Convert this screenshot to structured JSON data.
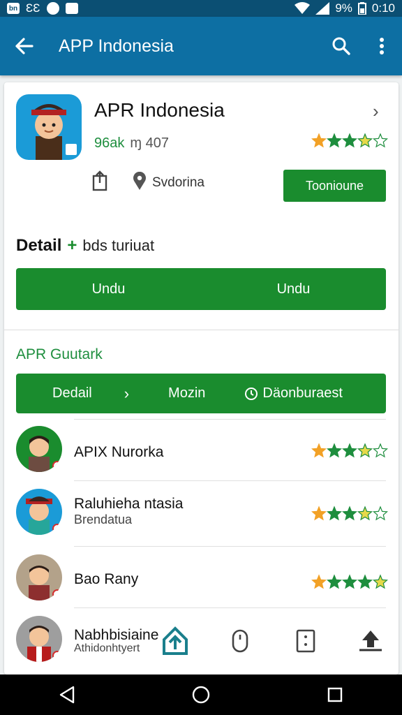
{
  "status_bar": {
    "left_box_text": "bn",
    "left_text": "ƐƐ",
    "battery_percent": "9%",
    "time": "0:10"
  },
  "app_bar": {
    "title": "APP Indonesia",
    "back_icon": "arrow-left-icon",
    "search_icon": "search-icon",
    "menu_icon": "more-vert-icon"
  },
  "app_header": {
    "name": "APR Indonesia",
    "meta_green": "96ak",
    "meta_gray": "ɱ 407",
    "rating": 3.5,
    "location": "Svdorina",
    "primary_button": "Toonioune"
  },
  "detail": {
    "heading_bold": "Detail",
    "plus": "+",
    "subtitle": "bds turiuat",
    "button_left": "Undu",
    "button_right": "Undu"
  },
  "section": {
    "title": "APR Guutark",
    "tabs": {
      "detail": "Dedail",
      "arrow": "›",
      "more": "Mozin",
      "download": "Däonburaest"
    }
  },
  "list": [
    {
      "title": "APIX Nurorka",
      "subtitle": "",
      "rating": 3.5
    },
    {
      "title": "Raluhieha ntasia",
      "subtitle": "Brendatua",
      "rating": 3.5
    },
    {
      "title": "Bao Rany",
      "subtitle": "",
      "rating": 4.5
    },
    {
      "title": "Nabhbisiaine",
      "subtitle": "Athidonhtyert",
      "rating": 0
    }
  ],
  "bottom_tools": [
    "home-upload-icon",
    "mouse-icon",
    "tablet-icon",
    "upload-icon"
  ],
  "nav": [
    "back-triangle-icon",
    "home-circle-icon",
    "recents-square-icon"
  ],
  "colors": {
    "status_bar": "#0b4f73",
    "app_bar": "#0d6fa3",
    "accent_green": "#1a8c2e",
    "star_orange": "#f2a126",
    "star_green": "#1e8e3e"
  }
}
